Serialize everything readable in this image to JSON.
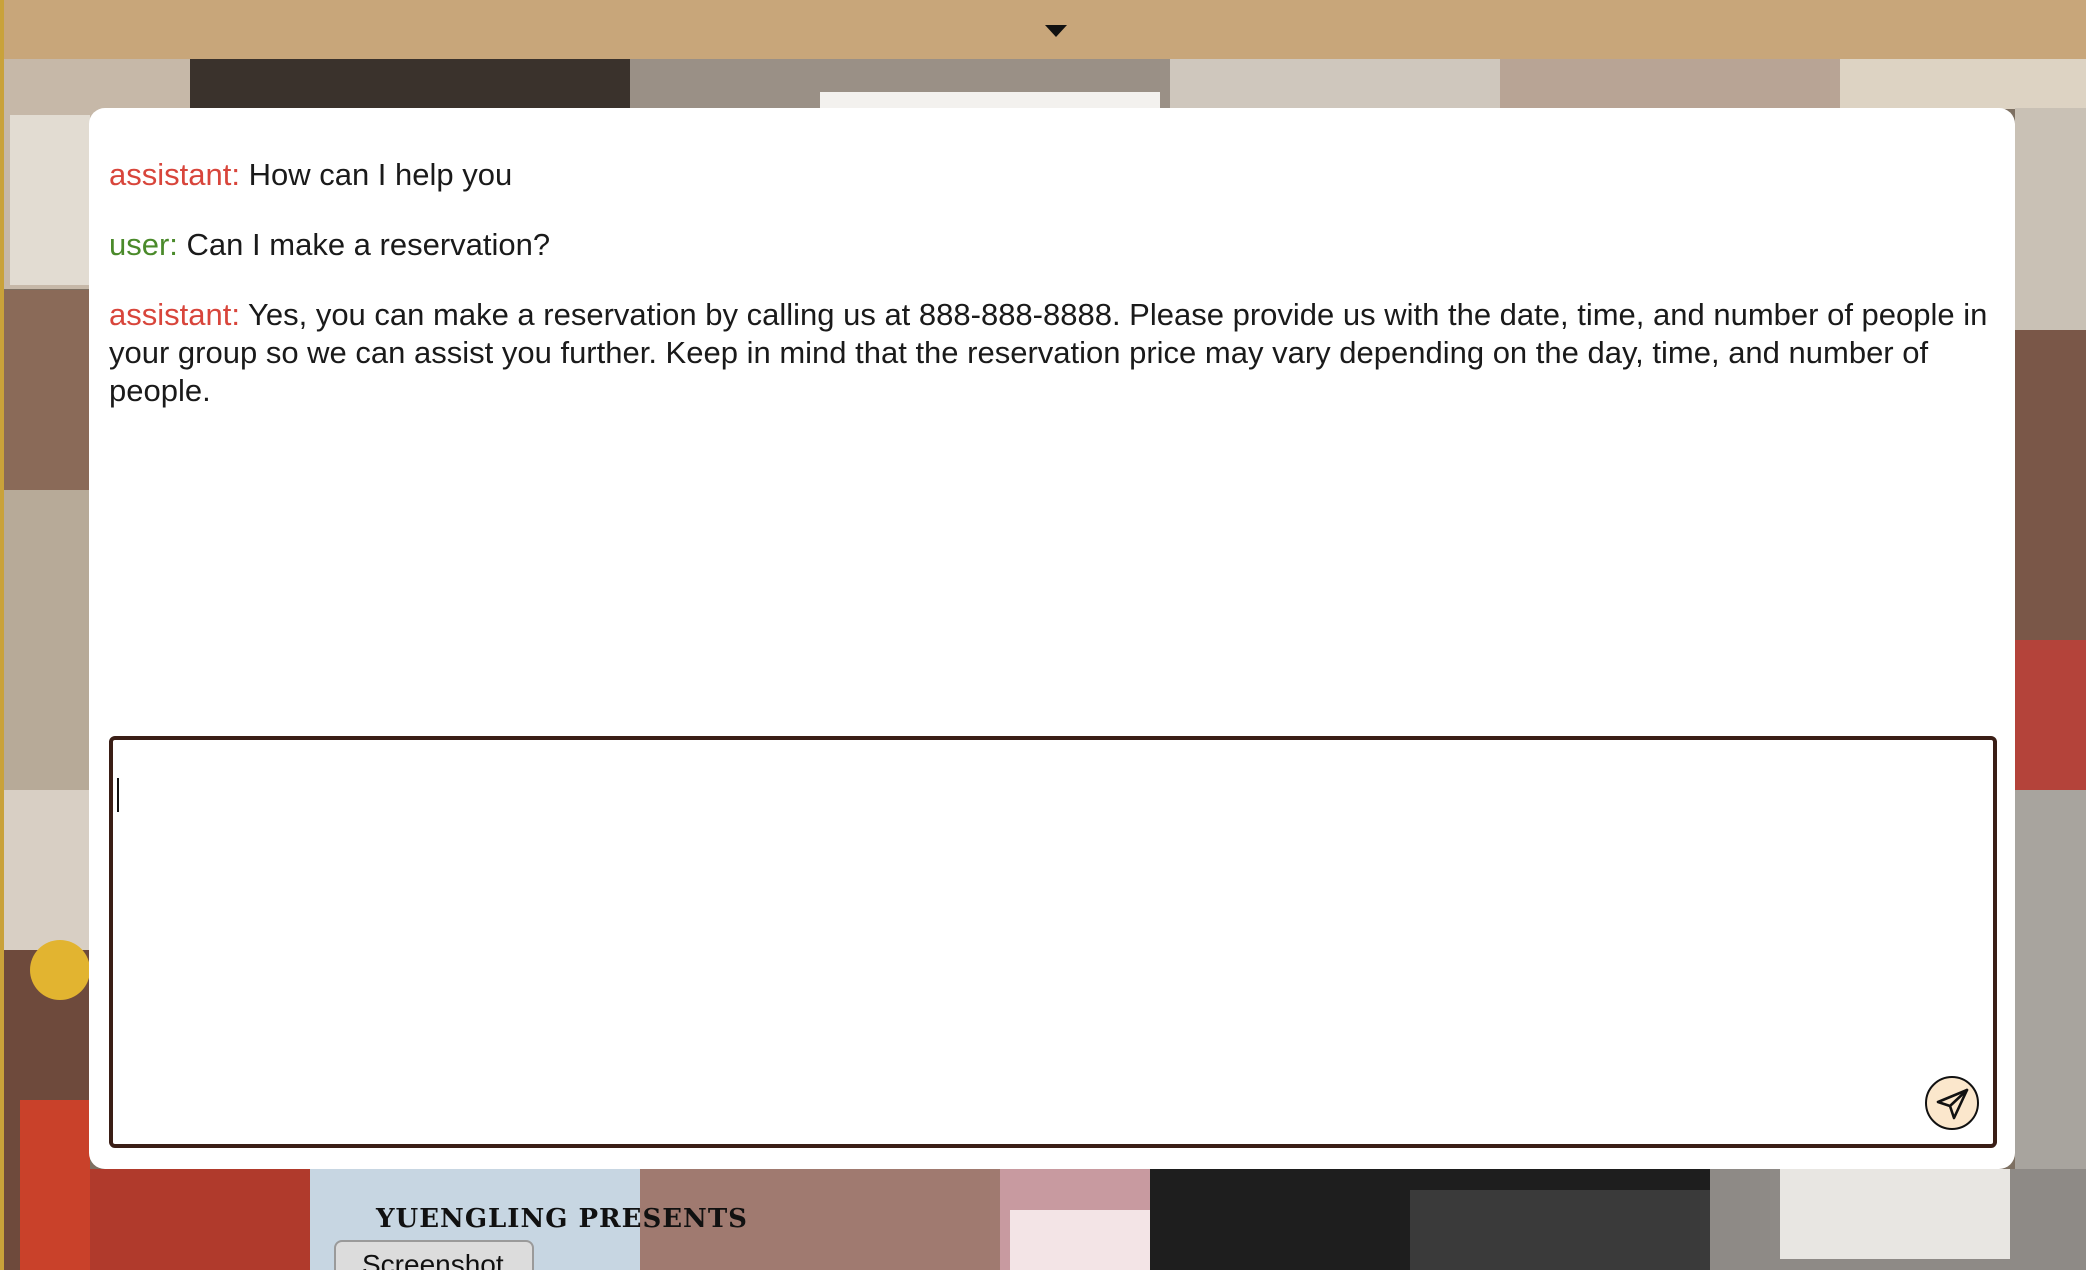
{
  "header": {
    "toggle_icon": "caret-down-icon"
  },
  "chat": {
    "messages": [
      {
        "role_label": "assistant:",
        "role": "assistant",
        "text": "How can I help you"
      },
      {
        "role_label": "user:",
        "role": "user",
        "text": "Can I make a reservation?"
      },
      {
        "role_label": "assistant:",
        "role": "assistant",
        "text": "Yes, you can make a reservation by calling us at 888-888-8888. Please provide us with the date, time, and number of people in your group so we can assist you further. Keep in mind that the reservation price may vary depending on the day, time, and number of people."
      }
    ],
    "input_value": "",
    "send_icon": "send-icon"
  },
  "background": {
    "poster_text": "YUENGLING PRESENTS",
    "screenshot_tab_label": "Screenshot"
  },
  "colors": {
    "header_bg": "#c8a67a",
    "assistant_label": "#d8453b",
    "user_label": "#4a8a2a",
    "input_border": "#3a1e16",
    "send_button_bg": "#fbe7cc"
  }
}
